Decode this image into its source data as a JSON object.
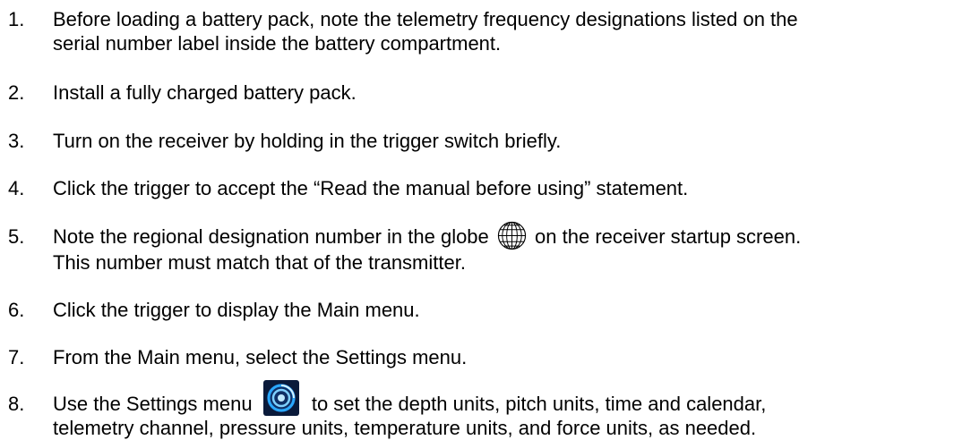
{
  "steps": [
    {
      "number": "1.",
      "line1": "Before loading a battery pack, note the telemetry frequency designations listed on the",
      "line2": "serial number label inside the battery compartment."
    },
    {
      "number": "2.",
      "line1": "Install a fully charged battery pack."
    },
    {
      "number": "3.",
      "line1": "Turn on the receiver by holding in the trigger switch briefly."
    },
    {
      "number": "4.",
      "line1": "Click the trigger to accept the “Read the manual before using” statement."
    },
    {
      "number": "5.",
      "line1_before": "Note the regional designation number in the globe",
      "line1_after": "on the receiver startup screen.",
      "line2": "This number must match that of the transmitter.",
      "icon": "globe-icon"
    },
    {
      "number": "6.",
      "line1": "Click the trigger to display the Main menu."
    },
    {
      "number": "7.",
      "line1": "From the Main menu, select the Settings menu."
    },
    {
      "number": "8.",
      "line1_before": "Use the Settings menu",
      "line1_after": "to set the depth units, pitch units, time and calendar,",
      "line2": "telemetry channel, pressure units, temperature units, and force units, as needed.",
      "icon": "settings-icon"
    }
  ],
  "colors": {
    "text": "#000000",
    "settings_icon_bg": "#0a1a3a",
    "settings_icon_ring": "#2aa8ff"
  }
}
